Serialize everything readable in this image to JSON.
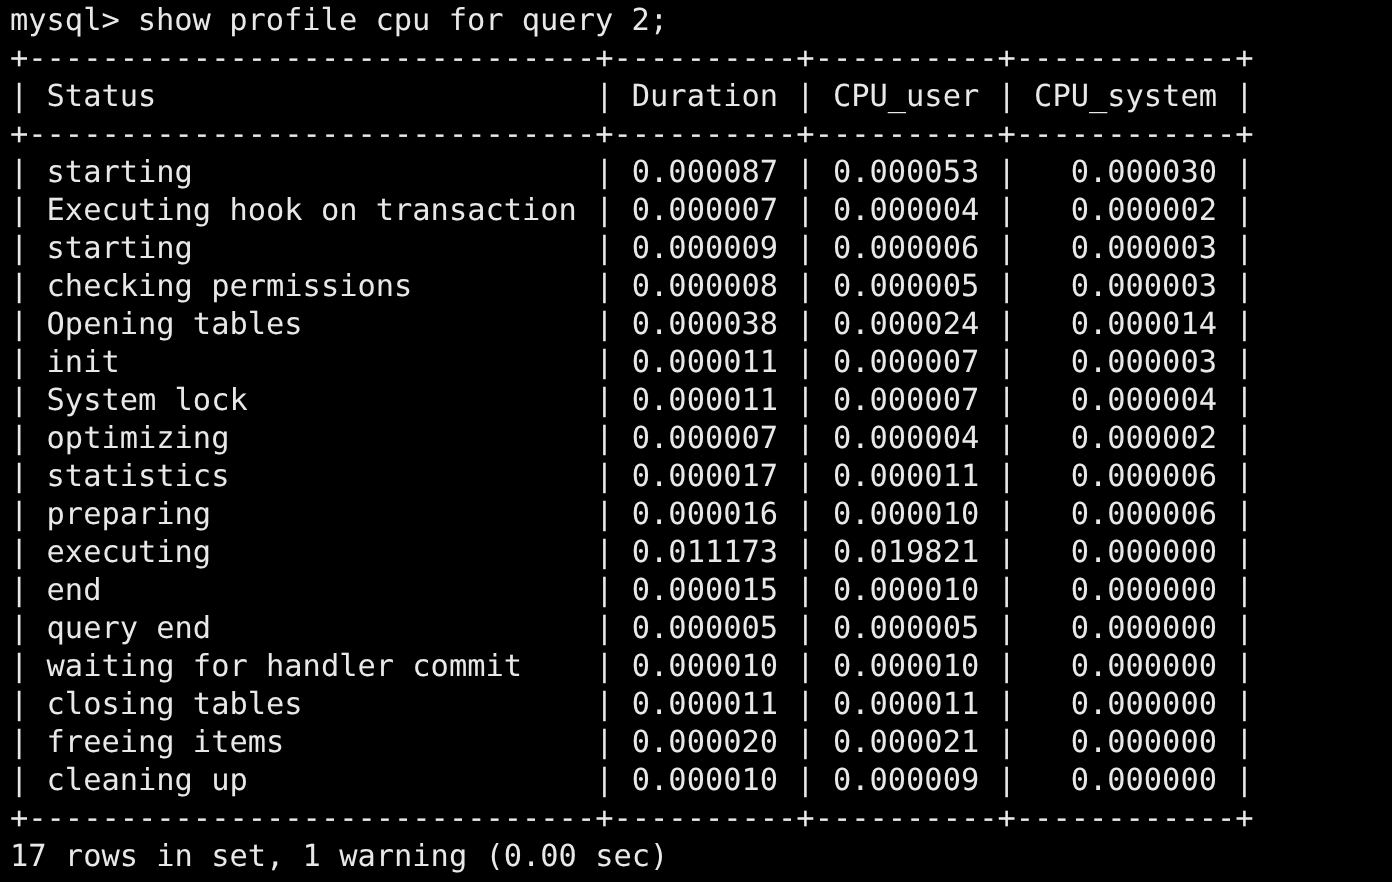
{
  "prompt": "mysql>",
  "command": "show profile cpu for query 2;",
  "output_lines": [
    "+-------------------------------+----------+----------+------------+",
    "| Status                        | Duration | CPU_user | CPU_system |",
    "+-------------------------------+----------+----------+------------+",
    "| starting                      | 0.000087 | 0.000053 |   0.000030 |",
    "| Executing hook on transaction | 0.000007 | 0.000004 |   0.000002 |",
    "| starting                      | 0.000009 | 0.000006 |   0.000003 |",
    "| checking permissions          | 0.000008 | 0.000005 |   0.000003 |",
    "| Opening tables                | 0.000038 | 0.000024 |   0.000014 |",
    "| init                          | 0.000011 | 0.000007 |   0.000003 |",
    "| System lock                   | 0.000011 | 0.000007 |   0.000004 |",
    "| optimizing                    | 0.000007 | 0.000004 |   0.000002 |",
    "| statistics                    | 0.000017 | 0.000011 |   0.000006 |",
    "| preparing                     | 0.000016 | 0.000010 |   0.000006 |",
    "| executing                     | 0.011173 | 0.019821 |   0.000000 |",
    "| end                           | 0.000015 | 0.000010 |   0.000000 |",
    "| query end                     | 0.000005 | 0.000005 |   0.000000 |",
    "| waiting for handler commit    | 0.000010 | 0.000010 |   0.000000 |",
    "| closing tables                | 0.000011 | 0.000011 |   0.000000 |",
    "| freeing items                 | 0.000020 | 0.000021 |   0.000000 |",
    "| cleaning up                   | 0.000010 | 0.000009 |   0.000000 |",
    "+-------------------------------+----------+----------+------------+"
  ],
  "summary": "17 rows in set, 1 warning (0.00 sec)"
}
